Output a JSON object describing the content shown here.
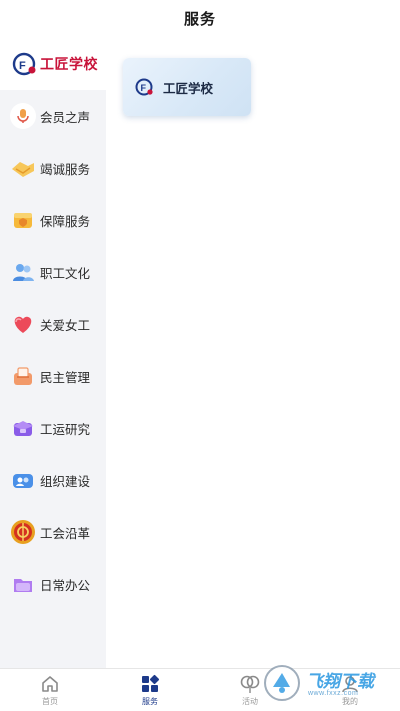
{
  "header": {
    "title": "服务"
  },
  "sidebar": {
    "items": [
      {
        "label": "工匠学校",
        "icon": "craftsman-school-logo-icon",
        "active": true
      },
      {
        "label": "会员之声",
        "icon": "microphone-icon"
      },
      {
        "label": "竭诚服务",
        "icon": "handshake-icon"
      },
      {
        "label": "保障服务",
        "icon": "shield-box-icon"
      },
      {
        "label": "职工文化",
        "icon": "people-icon"
      },
      {
        "label": "关爱女工",
        "icon": "heart-icon"
      },
      {
        "label": "民主管理",
        "icon": "ballot-icon"
      },
      {
        "label": "工运研究",
        "icon": "graduation-cap-icon"
      },
      {
        "label": "组织建设",
        "icon": "group-icon"
      },
      {
        "label": "工会沿革",
        "icon": "union-emblem-icon"
      },
      {
        "label": "日常办公",
        "icon": "folder-icon"
      }
    ]
  },
  "main": {
    "cards": [
      {
        "label": "工匠学校",
        "icon": "craftsman-school-logo-icon"
      }
    ]
  },
  "tabbar": {
    "tabs": [
      {
        "label": "首页",
        "icon": "home-icon"
      },
      {
        "label": "服务",
        "icon": "grid-icon",
        "active": true
      },
      {
        "label": "活动",
        "icon": "balloon-icon"
      },
      {
        "label": "我的",
        "icon": "user-icon"
      }
    ]
  },
  "watermark": {
    "text": "飞翔下载",
    "url": "www.fxxz.com"
  },
  "colors": {
    "active_red": "#c8143a",
    "active_blue": "#1d3a8a",
    "sidebar_bg": "#f3f4f7"
  }
}
